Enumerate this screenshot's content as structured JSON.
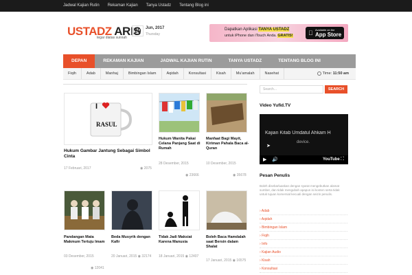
{
  "topnav": [
    "Jadwal Kajian Rutin",
    "Rekaman Kajian",
    "Tanya Ustadz",
    "Tentang Blog ini"
  ],
  "logo": {
    "part1": "USTADZ",
    "part2": "ARIS",
    "tagline": "tegar diatas sunnah"
  },
  "date": {
    "day": "29",
    "month_year": "Jun, 2017",
    "weekday": "Thursday"
  },
  "banner": {
    "line1_pre": "Dapatkan Aplikasi ",
    "line1_hl": "TANYA USTADZ",
    "line2_pre": "untuk iPhone dan iTouch Anda. ",
    "line2_hl": "GRATIS!",
    "store_small": "Available on the",
    "store_big": "App Store"
  },
  "mainnav": [
    "DEPAN",
    "REKAMAN KAJIAN",
    "JADWAL KAJIAN RUTIN",
    "TANYA USTADZ",
    "TENTANG BLOG INI"
  ],
  "subnav": [
    "Fiqih",
    "Adab",
    "Manhaj",
    "Bimbingan Islam",
    "Aqidah",
    "Konsultasi",
    "Kisah",
    "Mu'amalah",
    "Nasehat"
  ],
  "time": {
    "label": "Time:",
    "value": "11:50 am"
  },
  "posts": [
    {
      "title": "Hukum Gambar Jantung Sebagai Simbol Cinta",
      "date": "17 Februari, 2017",
      "views": "2075",
      "mug_text": "I",
      "mug_text2": "RASUL"
    },
    {
      "title": "Hukum Wanita Pakai Celana Panjang Saat di Rumah",
      "date": "28 Desember, 2015",
      "views": "23666"
    },
    {
      "title": "Manfaat Bagi Mayit, Kiriman Pahala Baca al-Quran",
      "date": "10 Desember, 2015",
      "views": "35678"
    },
    {
      "title": "Pandangan Mata Makmum Tertuju Imam",
      "date": "03 Desember, 2015",
      "views": "12041"
    },
    {
      "title": "Beda Musyrik dengan Kafir",
      "date": "20 Januari, 2015",
      "views": "32174"
    },
    {
      "title": "Tidak Jadi Maksiat Karena Manusia",
      "date": "18 Januari, 2015",
      "views": "12407"
    },
    {
      "title": "Boleh Baca Hamdalah saat Bersin dalam Shalat",
      "date": "17 Januari, 2015",
      "views": "16575"
    }
  ],
  "sidebar": {
    "search_placeholder": "Search...",
    "search_btn": "SEARCH",
    "video_heading": "Video Yufid.TV",
    "video_title": "Kajian Kitab Umdatul Ahkam H",
    "video_msg": "device.",
    "video_brand": "YouTube",
    "pesan_heading": "Pesan Penulis",
    "pesan_text": "Boleh disebarluaskan dengan syarat mengebutkan alamat sumber, dan tidak mengubah apapun isi konten serta tidak untuk tujuan komersial kecuali dengan seizin penulis.",
    "categories": [
      "Adab",
      "Aqidah",
      "Bimbingan Islam",
      "Fiqih",
      "Info",
      "Kajian Audio",
      "Kisah",
      "Konsultasi"
    ]
  },
  "colors": {
    "accent": "#e8502a",
    "nav": "#9b9b9b",
    "topbar": "#1b1b1b"
  }
}
